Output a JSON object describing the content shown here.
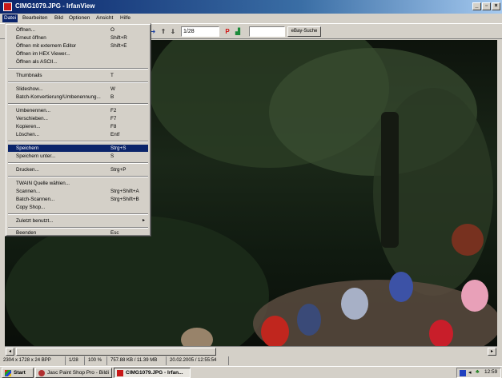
{
  "window": {
    "title": "CIMG1079.JPG - IrfanView",
    "buttons": [
      "_",
      "▫",
      "×"
    ]
  },
  "menubar": [
    "Datei",
    "Bearbeiten",
    "Bild",
    "Optionen",
    "Ansicht",
    "Hilfe"
  ],
  "toolbar": {
    "page_field": "1/28",
    "search_field": "",
    "search_button": "eBay-Suche"
  },
  "file_menu": {
    "items": [
      {
        "label": "Öffnen...",
        "shortcut": "O"
      },
      {
        "label": "Erneut öffnen",
        "shortcut": "Shift+R"
      },
      {
        "label": "Öffnen mit externem Editor",
        "shortcut": "Shift+E"
      },
      {
        "label": "Öffnen im HEX Viewer...",
        "shortcut": ""
      },
      {
        "label": "Öffnen als ASCII...",
        "shortcut": ""
      },
      {
        "label": "Thumbnails",
        "shortcut": "T"
      },
      {
        "label": "Slideshow...",
        "shortcut": "W"
      },
      {
        "label": "Batch-Konvertierung/Umbenennung...",
        "shortcut": "B"
      },
      {
        "label": "Umbenennen...",
        "shortcut": "F2"
      },
      {
        "label": "Verschieben...",
        "shortcut": "F7"
      },
      {
        "label": "Kopieren...",
        "shortcut": "F8"
      },
      {
        "label": "Löschen...",
        "shortcut": "Entf"
      },
      {
        "label": "Speichern",
        "shortcut": "Strg+S"
      },
      {
        "label": "Speichern unter...",
        "shortcut": "S"
      },
      {
        "label": "Drucken...",
        "shortcut": "Strg+P"
      },
      {
        "label": "TWAIN Quelle wählen...",
        "shortcut": ""
      },
      {
        "label": "Scannen...",
        "shortcut": "Strg+Shift+A"
      },
      {
        "label": "Batch-Scannen...",
        "shortcut": "Strg+Shift+B"
      },
      {
        "label": "Copy Shop...",
        "shortcut": ""
      },
      {
        "label": "Zuletzt benutzt...",
        "shortcut": ""
      },
      {
        "label": "Beenden",
        "shortcut": "Esc"
      }
    ]
  },
  "statusbar": {
    "dimensions": "2304 x 1728 x 24 BPP",
    "index": "1/28",
    "zoom": "100 %",
    "filesize": "757.88 KB / 11.39 MB",
    "datetime": "20.02.2005 / 12:55:54"
  },
  "taskbar": {
    "start": "Start",
    "tasks": [
      "Jasc Paint Shop Pro - Bildi",
      "CIMG1079.JPG - Irfan..."
    ],
    "clock": "12:59"
  },
  "colors": {
    "title_gradient_start": "#0a246a",
    "menu_highlight": "#0a246a",
    "window_face": "#d4d0c8"
  }
}
